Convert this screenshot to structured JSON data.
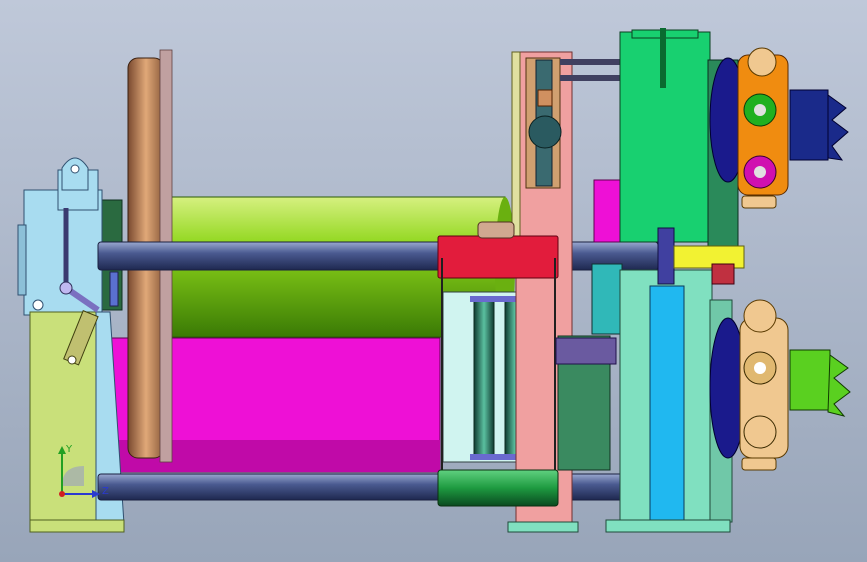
{
  "viewport": {
    "background_top": "#bcc6d7",
    "background_bottom": "#9ba7ba"
  },
  "triad": {
    "y_label": "Y",
    "z_label": "Z",
    "y_color": "#22a022",
    "z_color": "#2a3ad0",
    "x_color": "#d02020"
  },
  "colors": {
    "frame_light_blue": "#a8dcf0",
    "frame_yellow": "#c9e07a",
    "drum_green": "#8ed61a",
    "drum_flange": "#d8a070",
    "magenta_base": "#ee10d6",
    "shaft": "#3a4a7c",
    "red_hub": "#e21c3c",
    "salmon_plate": "#f0a0a0",
    "gearbox_green": "#18d070",
    "motor_orange": "#f08c10",
    "motor_tan": "#f0c890",
    "navy": "#1a1a8c",
    "yellow_shaft": "#f2f232",
    "cyan_post": "#20b8f0",
    "mint": "#80e0c0"
  }
}
